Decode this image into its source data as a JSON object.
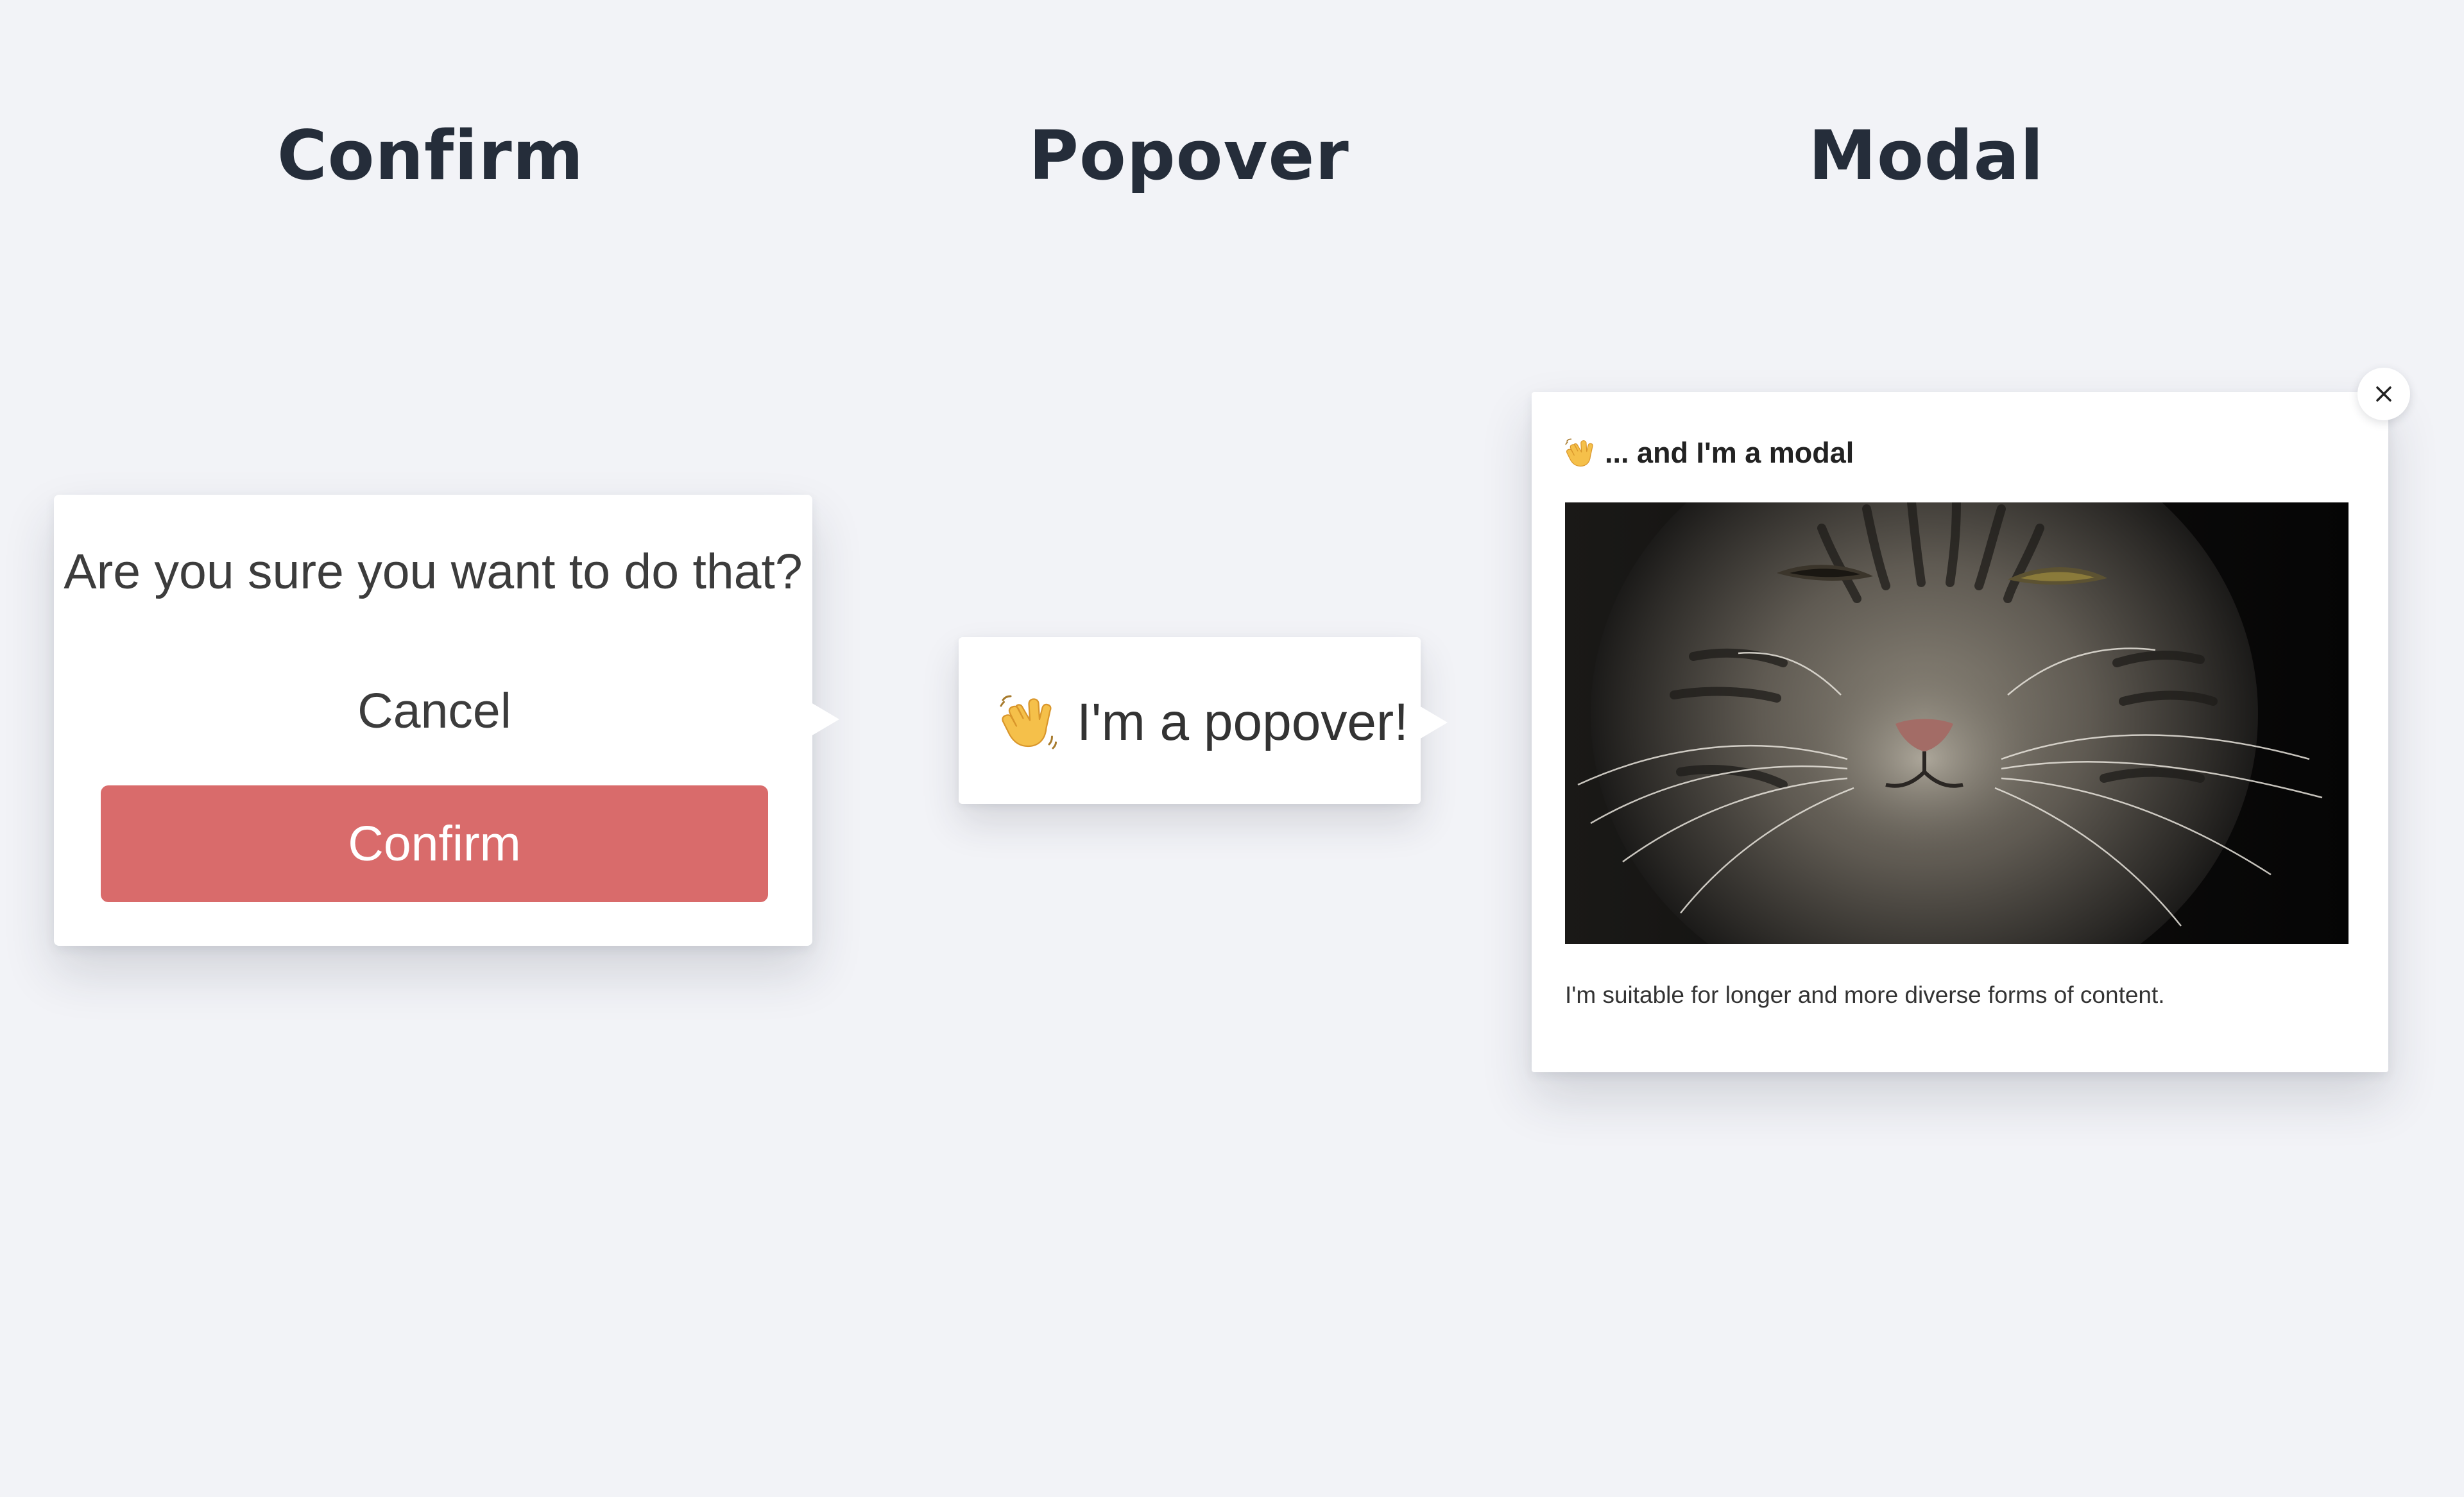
{
  "headings": {
    "confirm": "Confirm",
    "popover": "Popover",
    "modal": "Modal"
  },
  "confirm_dialog": {
    "question": "Are you sure you want to do that?",
    "cancel_label": "Cancel",
    "confirm_label": "Confirm",
    "confirm_color": "#d96b6b"
  },
  "popover": {
    "icon": "waving-hand-icon",
    "text": "I'm a popover!"
  },
  "modal": {
    "icon": "waving-hand-icon",
    "title": "... and I'm a modal",
    "image": "cat-photo",
    "body": "I'm suitable for longer and more diverse forms of content.",
    "close_icon": "close-icon"
  },
  "colors": {
    "background": "#f2f3f7",
    "heading": "#252d3a",
    "panel": "#ffffff"
  }
}
